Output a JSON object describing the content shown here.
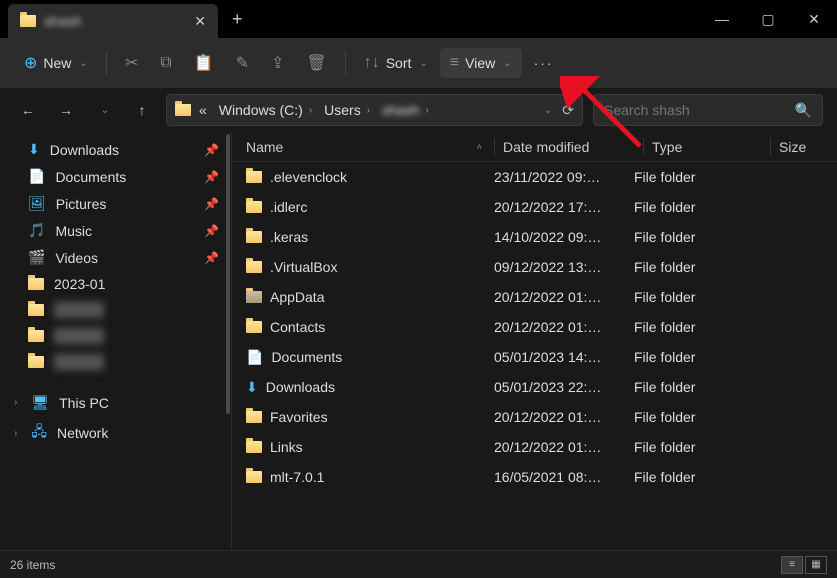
{
  "tab": {
    "title": "shash",
    "close_glyph": "✕",
    "new_tab_glyph": "+"
  },
  "window_controls": {
    "min": "—",
    "max": "▢",
    "close": "✕"
  },
  "toolbar": {
    "new_label": "New",
    "sort_label": "Sort",
    "view_label": "View",
    "more_glyph": "···"
  },
  "nav": {
    "back": "←",
    "forward": "→",
    "up": "↑"
  },
  "address": {
    "root_glyph": "«",
    "crumbs": [
      {
        "label": "Windows (C:)"
      },
      {
        "label": "Users"
      },
      {
        "label": "shash",
        "blur": true
      }
    ]
  },
  "search": {
    "placeholder": "Search shash"
  },
  "sidebar": {
    "quick": [
      {
        "icon": "download",
        "label": "Downloads",
        "pinned": true
      },
      {
        "icon": "document",
        "label": "Documents",
        "pinned": true
      },
      {
        "icon": "picture",
        "label": "Pictures",
        "pinned": true
      },
      {
        "icon": "music",
        "label": "Music",
        "pinned": true
      },
      {
        "icon": "video",
        "label": "Videos",
        "pinned": true
      },
      {
        "icon": "folder",
        "label": "2023-01",
        "pinned": false
      },
      {
        "icon": "folder",
        "label": "hidden1",
        "pinned": false,
        "blur": true
      },
      {
        "icon": "folder",
        "label": "hidden2",
        "pinned": false,
        "blur": true
      },
      {
        "icon": "folder",
        "label": "hidden3",
        "pinned": false,
        "blur": true
      }
    ],
    "roots": [
      {
        "icon": "pc",
        "label": "This PC"
      },
      {
        "icon": "network",
        "label": "Network"
      }
    ]
  },
  "columns": {
    "name": "Name",
    "date": "Date modified",
    "type": "Type",
    "size": "Size"
  },
  "items": [
    {
      "name": ".elevenclock",
      "date": "23/11/2022 09:…",
      "type": "File folder",
      "icon": "folder"
    },
    {
      "name": ".idlerc",
      "date": "20/12/2022 17:…",
      "type": "File folder",
      "icon": "folder"
    },
    {
      "name": ".keras",
      "date": "14/10/2022 09:…",
      "type": "File folder",
      "icon": "folder"
    },
    {
      "name": ".VirtualBox",
      "date": "09/12/2022 13:…",
      "type": "File folder",
      "icon": "folder"
    },
    {
      "name": "AppData",
      "date": "20/12/2022 01:…",
      "type": "File folder",
      "icon": "folder-hidden"
    },
    {
      "name": "Contacts",
      "date": "20/12/2022 01:…",
      "type": "File folder",
      "icon": "folder"
    },
    {
      "name": "Documents",
      "date": "05/01/2023 14:…",
      "type": "File folder",
      "icon": "document"
    },
    {
      "name": "Downloads",
      "date": "05/01/2023 22:…",
      "type": "File folder",
      "icon": "download"
    },
    {
      "name": "Favorites",
      "date": "20/12/2022 01:…",
      "type": "File folder",
      "icon": "folder"
    },
    {
      "name": "Links",
      "date": "20/12/2022 01:…",
      "type": "File folder",
      "icon": "folder"
    },
    {
      "name": "mlt-7.0.1",
      "date": "16/05/2021 08:…",
      "type": "File folder",
      "icon": "folder"
    }
  ],
  "status": {
    "count_label": "26 items"
  }
}
